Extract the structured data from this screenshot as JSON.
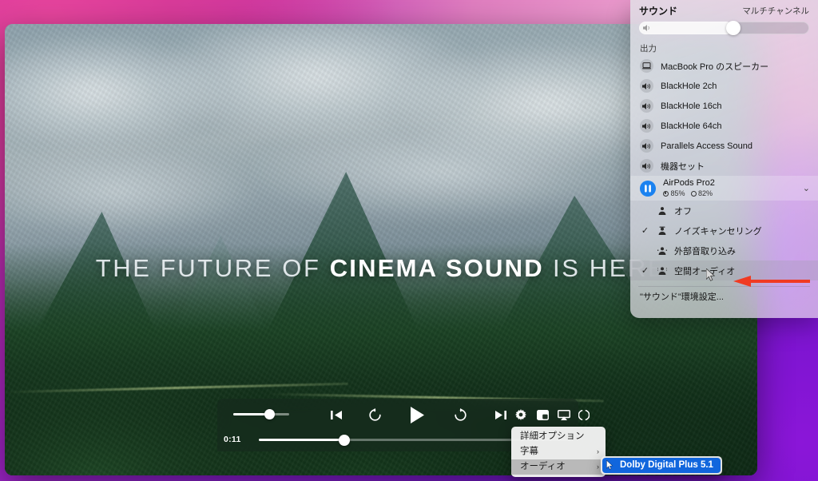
{
  "video": {
    "hero_title_prefix": "THE FUTURE OF ",
    "hero_title_bold": "CINEMA SOUND",
    "hero_title_suffix": " IS HERE",
    "current_time": "0:11"
  },
  "player_controls": {
    "volume_icon": "volume-slider",
    "previous_label": "previous-track",
    "rewind_label": "rewind-15",
    "play_label": "play",
    "forward_label": "forward-15",
    "next_label": "next-track",
    "settings_label": "settings-gear",
    "pip_label": "picture-in-picture",
    "airplay_label": "airplay",
    "fullscreen_label": "fullscreen"
  },
  "context_menu": {
    "items": [
      {
        "label": "詳細オプション",
        "has_submenu": false,
        "selected": false
      },
      {
        "label": "字幕",
        "has_submenu": true,
        "selected": false
      },
      {
        "label": "オーディオ",
        "has_submenu": true,
        "selected": true
      }
    ],
    "submenu_arrow": "›",
    "submenu": {
      "selected_item": "Dolby Digital Plus 5.1"
    }
  },
  "sound_panel": {
    "title": "サウンド",
    "subtitle": "マルチチャンネル",
    "volume_percent": 55,
    "output_section": "出力",
    "devices": [
      {
        "label": "MacBook Pro のスピーカー",
        "icon": "laptop-icon"
      },
      {
        "label": "BlackHole 2ch",
        "icon": "speaker-icon"
      },
      {
        "label": "BlackHole 16ch",
        "icon": "speaker-icon"
      },
      {
        "label": "BlackHole 64ch",
        "icon": "speaker-icon"
      },
      {
        "label": "Parallels Access Sound",
        "icon": "speaker-icon"
      },
      {
        "label": "機器セット",
        "icon": "speaker-icon"
      }
    ],
    "airpods": {
      "name": "AirPods Pro2",
      "battery_left": "85%",
      "battery_right": "82%",
      "chevron": "⌄"
    },
    "noise_control": [
      {
        "label": "オフ",
        "checked": false,
        "selected": false
      },
      {
        "label": "ノイズキャンセリング",
        "checked": true,
        "selected": false
      },
      {
        "label": "外部音取り込み",
        "checked": false,
        "selected": false
      },
      {
        "label": "空間オーディオ",
        "checked": true,
        "selected": true
      }
    ],
    "check_glyph": "✓",
    "preferences_label": "\"サウンド\"環境設定..."
  },
  "annotation": {
    "arrow_color": "#f03a22",
    "points_to": "空間オーディオ"
  }
}
